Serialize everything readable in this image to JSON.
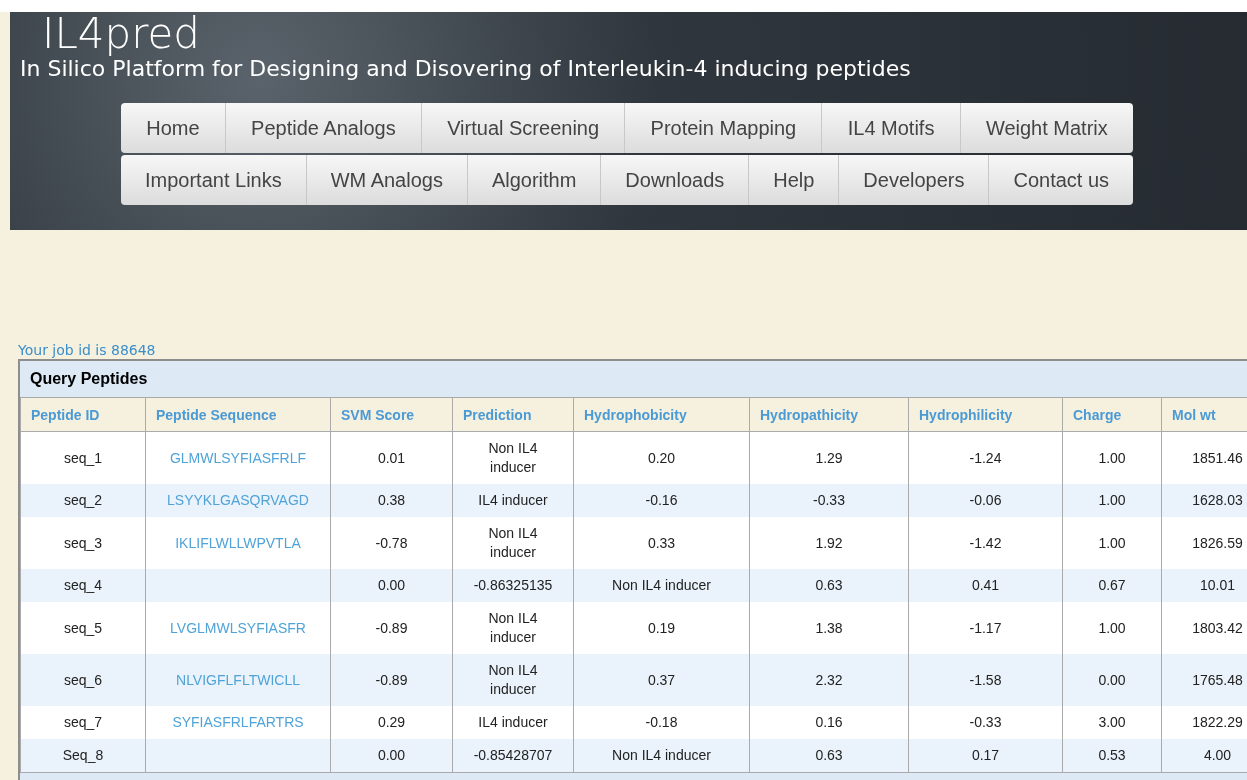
{
  "header": {
    "title": "IL4pred",
    "subtitle": "In Silico Platform for Designing and Disovering of Interleukin-4 inducing peptides"
  },
  "nav": [
    [
      "Home",
      "Peptide Analogs",
      "Virtual Screening",
      "Protein Mapping",
      "IL4 Motifs",
      "Weight Matrix"
    ],
    [
      "Important Links",
      "WM Analogs",
      "Algorithm",
      "Downloads",
      "Help",
      "Developers",
      "Contact us"
    ]
  ],
  "job_id": "Your job id is 88648",
  "table": {
    "title": "Query Peptides",
    "columns": [
      {
        "label": "Peptide ID",
        "kind": "text"
      },
      {
        "label": "Peptide Sequence",
        "kind": "link"
      },
      {
        "label": "SVM Score",
        "kind": "text"
      },
      {
        "label": "Prediction",
        "kind": "text"
      },
      {
        "label": "Hydrophobicity",
        "kind": "text"
      },
      {
        "label": "Hydropathicity",
        "kind": "text"
      },
      {
        "label": "Hydrophilicity",
        "kind": "text"
      },
      {
        "label": "Charge",
        "kind": "text"
      },
      {
        "label": "Mol wt",
        "kind": "text"
      }
    ],
    "rows": [
      [
        "seq_1",
        "GLMWLSYFIASFRLF",
        "0.01",
        "Non IL4 inducer",
        "0.20",
        "1.29",
        "-1.24",
        "1.00",
        "1851.46"
      ],
      [
        "seq_2",
        "LSYYKLGASQRVAGD",
        "0.38",
        "IL4 inducer",
        "-0.16",
        "-0.33",
        "-0.06",
        "1.00",
        "1628.03"
      ],
      [
        "seq_3",
        "IKLIFLWLLWPVTLA",
        "-0.78",
        "Non IL4 inducer",
        "0.33",
        "1.92",
        "-1.42",
        "1.00",
        "1826.59"
      ],
      [
        "seq_4",
        null,
        "0.00",
        "-0.86325135",
        "Non IL4 inducer",
        "0.63",
        "0.41",
        "0.67",
        "10.01"
      ],
      [
        "seq_5",
        "LVGLMWLSYFIASFR",
        "-0.89",
        "Non IL4 inducer",
        "0.19",
        "1.38",
        "-1.17",
        "1.00",
        "1803.42"
      ],
      [
        "seq_6",
        "NLVIGFLFLTWICLL",
        "-0.89",
        "Non IL4 inducer",
        "0.37",
        "2.32",
        "-1.58",
        "0.00",
        "1765.48"
      ],
      [
        "seq_7",
        "SYFIASFRLFARTRS",
        "0.29",
        "IL4 inducer",
        "-0.18",
        "0.16",
        "-0.33",
        "3.00",
        "1822.29"
      ],
      [
        "Seq_8",
        null,
        "0.00",
        "-0.85428707",
        "Non IL4 inducer",
        "0.63",
        "0.17",
        "0.53",
        "4.00"
      ]
    ]
  }
}
